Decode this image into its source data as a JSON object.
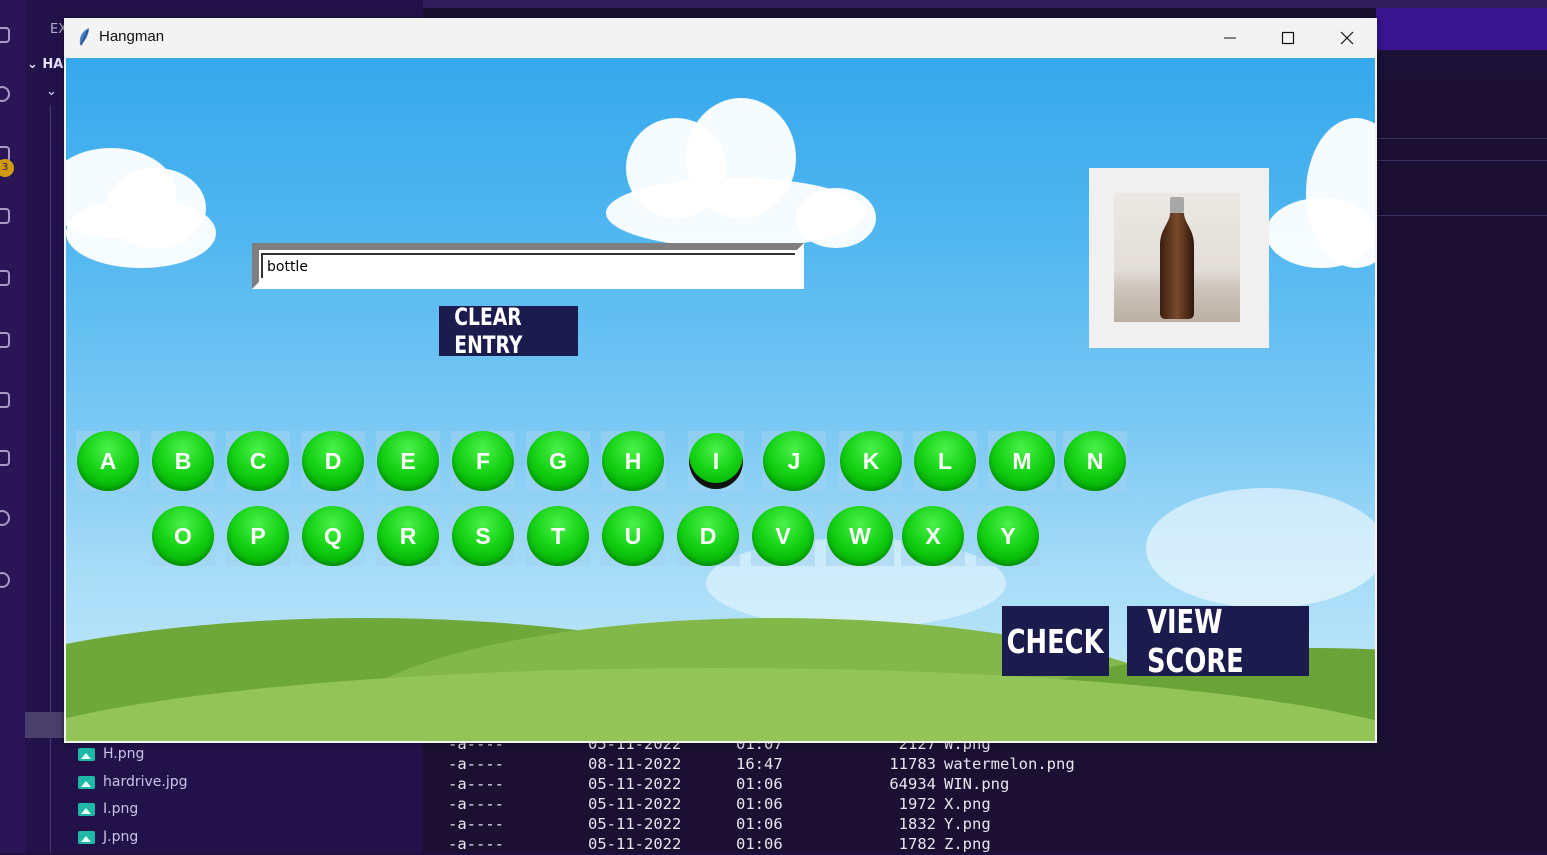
{
  "background": {
    "sidebar_title": "EX",
    "tree_root": "HA",
    "badge_count": "3",
    "files": [
      "H.png",
      "hardrive.jpg",
      "I.png",
      "J.png"
    ],
    "terminal_lines": [
      {
        "mode": "-a----",
        "date": "05-11-2022",
        "time": "01:07",
        "size": "2127",
        "name": "W.png"
      },
      {
        "mode": "-a----",
        "date": "08-11-2022",
        "time": "16:47",
        "size": "11783",
        "name": "watermelon.png"
      },
      {
        "mode": "-a----",
        "date": "05-11-2022",
        "time": "01:06",
        "size": "64934",
        "name": "WIN.png"
      },
      {
        "mode": "-a----",
        "date": "05-11-2022",
        "time": "01:06",
        "size": "1972",
        "name": "X.png"
      },
      {
        "mode": "-a----",
        "date": "05-11-2022",
        "time": "01:06",
        "size": "1832",
        "name": "Y.png"
      },
      {
        "mode": "-a----",
        "date": "05-11-2022",
        "time": "01:06",
        "size": "1782",
        "name": "Z.png"
      }
    ]
  },
  "window": {
    "title": "Hangman",
    "icon": "feather-icon",
    "controls": [
      "minimize-icon",
      "maximize-icon",
      "close-icon"
    ]
  },
  "game": {
    "entry_value": "bottle",
    "clear_label": "CLEAR ENTRY",
    "check_label": "CHECK",
    "score_label": "VIEW SCORE",
    "hint_image": "bottle-photo",
    "row1": [
      "A",
      "B",
      "C",
      "D",
      "E",
      "F",
      "G",
      "H",
      "I",
      "J",
      "K",
      "L",
      "M",
      "N"
    ],
    "row2": [
      "O",
      "P",
      "Q",
      "R",
      "S",
      "T",
      "U",
      "D",
      "V",
      "W",
      "X",
      "Y"
    ]
  },
  "colors": {
    "button_dark": "#1b1b4d",
    "letter_green": "#16d316",
    "sky": "#4fb6f0"
  }
}
